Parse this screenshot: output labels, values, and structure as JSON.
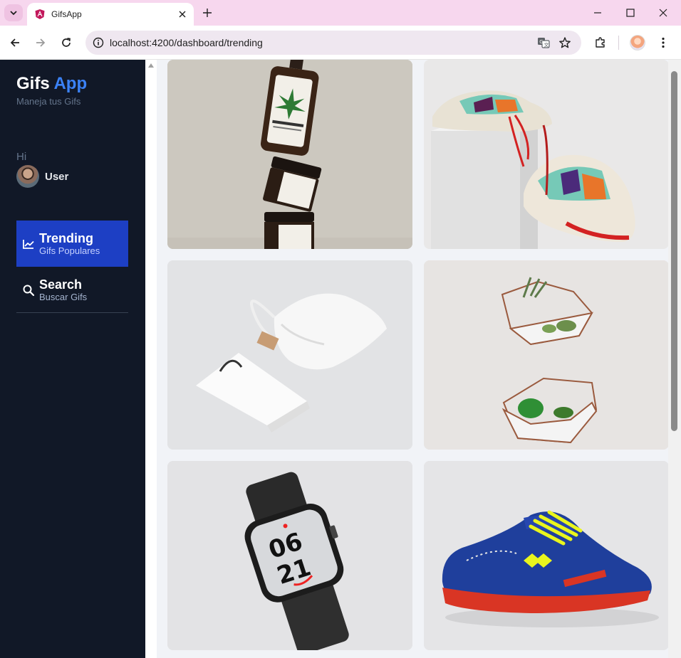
{
  "browser": {
    "tab_title": "GifsApp",
    "url": "localhost:4200/dashboard/trending"
  },
  "sidebar": {
    "brand_main": "Gifs",
    "brand_accent": "App",
    "subtitle": "Maneja tus Gifs",
    "greeting": "Hi",
    "user_name": "User",
    "menu": [
      {
        "title": "Trending",
        "subtitle": "Gifs Populares",
        "icon": "trending-icon",
        "active": true
      },
      {
        "title": "Search",
        "subtitle": "Buscar Gifs",
        "icon": "search-icon",
        "active": false
      }
    ]
  },
  "gallery": {
    "images": [
      {
        "subject": "product-bottles"
      },
      {
        "subject": "sneakers-pedestal"
      },
      {
        "subject": "bag-mockup"
      },
      {
        "subject": "terrariums"
      },
      {
        "subject": "smartwatch"
      },
      {
        "subject": "soccer-shoe"
      }
    ]
  },
  "colors": {
    "sidebar_bg": "#111827",
    "active_menu": "#1d3fc4",
    "brand_accent": "#3b82f6",
    "tabstrip": "#f7d7ee"
  }
}
